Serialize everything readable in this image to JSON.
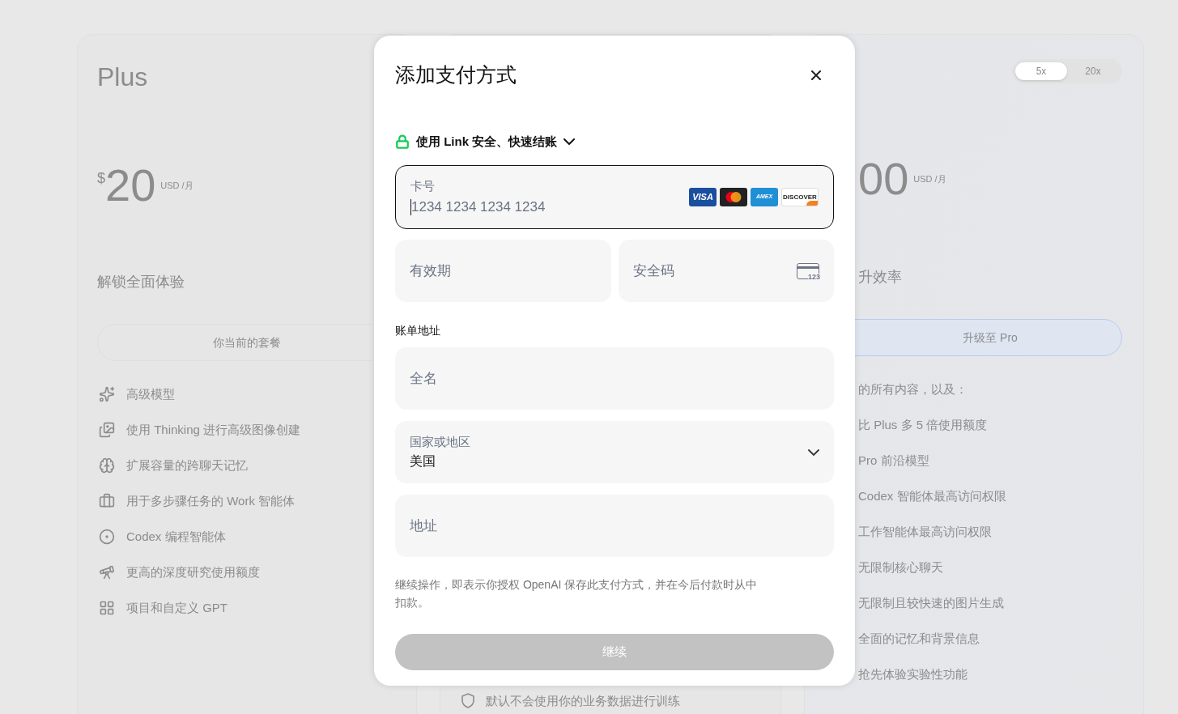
{
  "background": {
    "plus": {
      "name": "Plus",
      "currency": "$",
      "price": "20",
      "period": "USD /月",
      "tagline": "解锁全面体验",
      "button": "你当前的套餐",
      "features": [
        "高级模型",
        "使用 Thinking 进行高级图像创建",
        "扩展容量的跨聊天记忆",
        "用于多步骤任务的 Work 智能体",
        "Codex 编程智能体",
        "更高的深度研究使用额度",
        "项目和自定义 GPT"
      ]
    },
    "middle": {
      "features": [
        "默认不会使用你的业务数据进行训练"
      ]
    },
    "pro": {
      "toggle": [
        {
          "label": "5x",
          "selected": true
        },
        {
          "label": "20x",
          "selected": false
        }
      ],
      "price": "00",
      "period": "USD /月",
      "tagline": "升效率",
      "button": "升级至 Pro",
      "features": [
        "的所有内容，以及：",
        "比 Plus 多 5 倍使用额度",
        "Pro 前沿模型",
        "Codex 智能体最高访问权限",
        "工作智能体最高访问权限",
        "无限制核心聊天",
        "无限制且较快速的图片生成",
        "全面的记忆和背景信息",
        "抢先体验实验性功能"
      ]
    }
  },
  "dialog": {
    "title": "添加支付方式",
    "link": "使用 Link 安全、快速结账",
    "card_number": {
      "label": "卡号",
      "placeholder": "1234 1234 1234 1234",
      "focused": true,
      "brands": [
        {
          "kind": "visa",
          "label": "VISA"
        },
        {
          "kind": "mastercard"
        },
        {
          "kind": "amex",
          "label": "AMEX"
        },
        {
          "kind": "discover",
          "label": "DISCOVER"
        }
      ]
    },
    "expiry": {
      "placeholder": "有效期"
    },
    "cvc": {
      "placeholder": "安全码",
      "hint": "123"
    },
    "billing_heading": "账单地址",
    "full_name": {
      "placeholder": "全名"
    },
    "country": {
      "label": "国家或地区",
      "value": "美国"
    },
    "address": {
      "placeholder": "地址"
    },
    "disclaimer": "继续操作，即表示你授权 OpenAI 保存此支付方式，并在今后付款时从中扣款。",
    "submit": {
      "label": "继续",
      "disabled": true
    }
  }
}
